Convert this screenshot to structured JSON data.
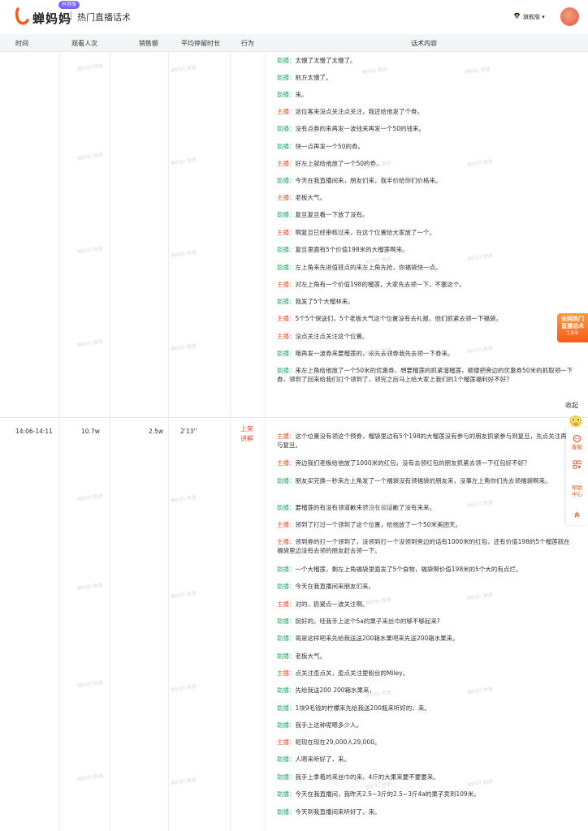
{
  "app": {
    "name": "蝉妈妈",
    "badge": "抖音版",
    "page_title": "热门直播话术"
  },
  "user": {
    "vip_label": "旗舰版"
  },
  "table": {
    "columns": [
      "时间",
      "观看人次",
      "销售额",
      "平均停留时长",
      "行为",
      "话术内容"
    ]
  },
  "segment1": {
    "lines": [
      {
        "role": "助播",
        "text": "太慢了太慢了太慢了。"
      },
      {
        "role": "助播",
        "text": "前方太慢了。"
      },
      {
        "role": "助播",
        "text": "来。"
      },
      {
        "role": "主播",
        "text": "这位客来没点关注点关注，我还给他发了个劵。"
      },
      {
        "role": "助播",
        "text": "没有点券的来再发一波钱来再发一个50的钱来。"
      },
      {
        "role": "助播",
        "text": "快一点再发一个50的券。"
      },
      {
        "role": "主播",
        "text": "好左上就给他放了一个50的券。"
      },
      {
        "role": "助播",
        "text": "今天在我直播间来，朋友们来，我半价给你们价格来。"
      },
      {
        "role": "主播",
        "text": "老板大气。"
      },
      {
        "role": "助播",
        "text": "复旦复旦看一下放了没有。"
      },
      {
        "role": "主播",
        "text": "啊复旦已经审核过来，在这个位置给大家放了一个。"
      },
      {
        "role": "助播",
        "text": "复旦里面有5个价值198米的大榴莲啊来。"
      },
      {
        "role": "助播",
        "text": "左上角来先进值班点的来左上角先抢，你福袋快一点。"
      },
      {
        "role": "主播",
        "text": "对左上角有一个价值198的榴莲，大家先去领一下，不塞这个。"
      },
      {
        "role": "助播",
        "text": "我发了5个大榴林来。"
      },
      {
        "role": "主播",
        "text": "5个5个保送们，5个老板大气这个位置没有去礼报，他们抓紧去领一下福袋，"
      },
      {
        "role": "主播",
        "text": "没点关注点关注这个位置。"
      },
      {
        "role": "助播",
        "text": "哦再发一波券来要榴莲的，来先去领券我先去领一下券来。"
      },
      {
        "role": "助播",
        "text": "来左上角给他放了一个50米的优惠券，想要榴莲的抓紧溜榴莲，顺便把旁边的优惠券50米的抓取领一下券，领到了回来给我们打个领到了，领完之后马上给大家上我们的1个榴莲福利好不好？"
      }
    ]
  },
  "segment2": {
    "time": "14:06-14:11",
    "viewers": "10.7w",
    "sales": "2.5w",
    "avg_stay": "2'13''",
    "action": [
      "上架",
      "讲解"
    ],
    "lines": [
      {
        "role": "主播",
        "text": "这个位置没有领这个预券，榴袋里边有5个198的大榴莲没有参与的朋友抓紧参与到复旦，先点关注再参与复旦。"
      },
      {
        "role": "主播",
        "text": "旁边我们老板给他放了1000米的红包，没有去领红包的朋友抓紧去领一下红包好不好？"
      },
      {
        "role": "助播",
        "text": "朋友买完换一秒来左上角发了一个福袋没有领福袋的朋友来，没事左上角你们先去领福袋啊来。"
      },
      {
        "role": "助播",
        "text": "要榴莲的有没有领道歉来领没有领道歉了没有来来。"
      },
      {
        "role": "主播",
        "text": "领到了打过一个领到了这个位置，给他放了一个50米美团天。"
      },
      {
        "role": "主播",
        "text": "领到券的打一个领到了，没领到打一个没领到旁边的话有1000米的红包，还有价值198的5个榴莲就在福袋里边没有去领的朋友赶去领一下。"
      },
      {
        "role": "助播",
        "text": "一个大榴莲，剩左上角福袋里面发了5个食物，福袋啊价值198米的5个大的有点烂。"
      },
      {
        "role": "助播",
        "text": "今天在我直播间来朋友们来。"
      },
      {
        "role": "主播",
        "text": "对的，抓紧点一波关注啊。"
      },
      {
        "role": "助播",
        "text": "挺好的。哇我手上这个5a的果子来丝巾的够不够起来?"
      },
      {
        "role": "助播",
        "text": "哥是这样吧来先给我送送200箱水果吧来先送200箱水果来。"
      },
      {
        "role": "助播",
        "text": "老板大气。"
      },
      {
        "role": "主播",
        "text": "点关注歪点关，歪点关注里粉丝的Miley。"
      },
      {
        "role": "助播",
        "text": "先给我送200 200箱水果来，"
      },
      {
        "role": "助播",
        "text": "1块9毛钱的柠檬来先给我送200瓶来听好的，来。"
      },
      {
        "role": "助播",
        "text": "我手上这种呢嗯多少人。"
      },
      {
        "role": "主播",
        "text": "呃现在现在29,000人29,000。"
      },
      {
        "role": "助播",
        "text": "人嗯来听好了，来。"
      },
      {
        "role": "助播",
        "text": "我手上拿着的来丝巾的来，4斤的大果来要不要要来。"
      },
      {
        "role": "助播",
        "text": "今天在我直播间，我昨天2.5~3斤的2.5~3斤4a的果子卖到109米。"
      },
      {
        "role": "助播",
        "text": "今天到我直播间来听好了，来。"
      }
    ]
  },
  "float": {
    "promo": [
      "全网热门",
      "直播话术"
    ],
    "promo_sub": "立即看",
    "collapse": "收起",
    "sidebar": [
      "客服",
      "帮助中心"
    ]
  },
  "watermark": "蝉妈妈 数据"
}
